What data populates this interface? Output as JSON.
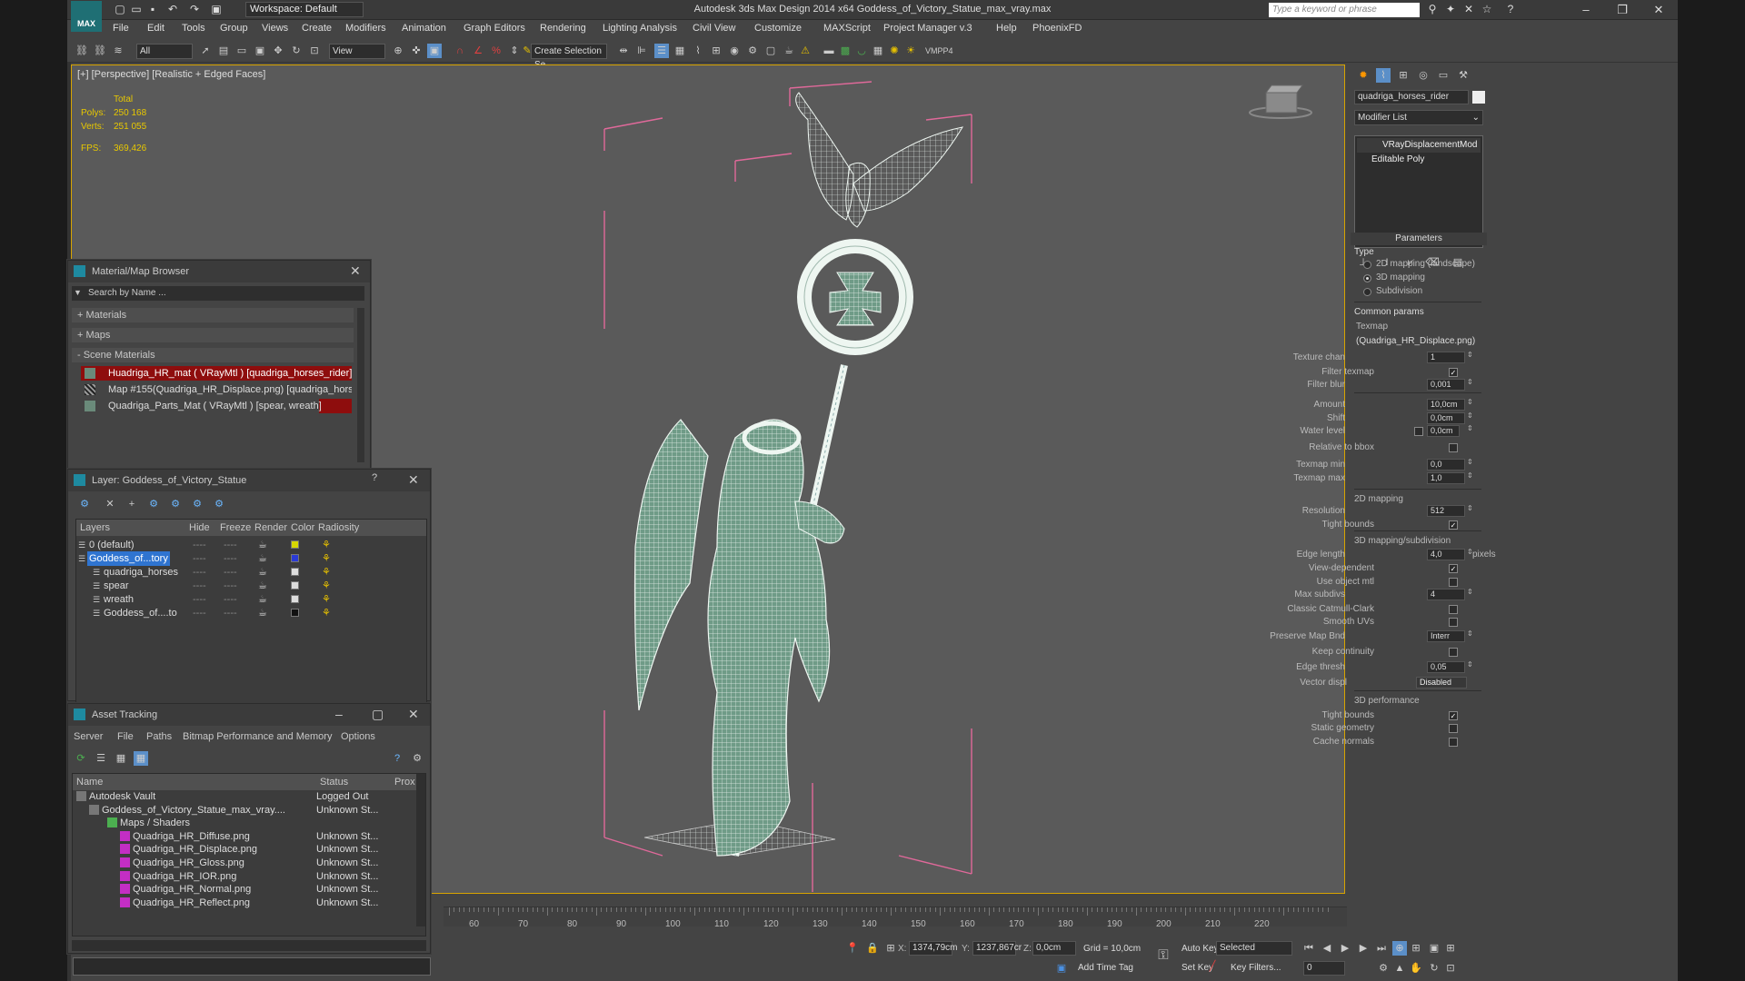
{
  "app": {
    "logo": "MAX",
    "workspace": "Workspace: Default",
    "title": "Autodesk 3ds Max Design 2014 x64     Goddess_of_Victory_Statue_max_vray.max",
    "search_placeholder": "Type a keyword or phrase"
  },
  "menus": [
    "File",
    "Edit",
    "Tools",
    "Group",
    "Views",
    "Create",
    "Modifiers",
    "Animation",
    "Graph Editors",
    "Rendering",
    "Lighting Analysis",
    "Civil View",
    "Customize",
    "MAXScript",
    "Project Manager v.3",
    "Help",
    "PhoenixFD"
  ],
  "toolbar": {
    "filter": "All",
    "refcoord": "View",
    "selection_set": "Create Selection Se",
    "vmpp": "VMPP4"
  },
  "viewport": {
    "label": "[+] [Perspective] [Realistic + Edged Faces]",
    "stats": {
      "heading": "Total",
      "polys_label": "Polys:",
      "polys": "250 168",
      "verts_label": "Verts:",
      "verts": "251 055",
      "fps_label": "FPS:",
      "fps": "369,426"
    }
  },
  "material_browser": {
    "title": "Material/Map Browser",
    "search": "Search by Name ...",
    "groups": [
      "+ Materials",
      "+ Maps",
      "- Scene Materials"
    ],
    "items": [
      "Huadriga_HR_mat ( VRayMtl ) [quadriga_horses_rider]",
      "Map #155(Quadriga_HR_Displace.png) [quadriga_hors...",
      "Quadriga_Parts_Mat ( VRayMtl ) [spear, wreath]"
    ]
  },
  "layer_dialog": {
    "title": "Layer: Goddess_of_Victory_Statue",
    "help": "?",
    "columns": [
      "Layers",
      "Hide",
      "Freeze",
      "Render",
      "Color",
      "Radiosity"
    ],
    "rows": [
      {
        "name": "0 (default)",
        "color": "#d7d700"
      },
      {
        "name": "Goddess_of...tory",
        "color": "#2b3bd6"
      },
      {
        "name": "quadriga_horses",
        "color": "#dddddd"
      },
      {
        "name": "spear",
        "color": "#dddddd"
      },
      {
        "name": "wreath",
        "color": "#dddddd"
      },
      {
        "name": "Goddess_of....to",
        "color": "#111111"
      }
    ]
  },
  "asset_tracking": {
    "title": "Asset Tracking",
    "menus": [
      "Server",
      "File",
      "Paths",
      "Bitmap Performance and Memory",
      "Options"
    ],
    "columns": [
      "Name",
      "Status",
      "Prox"
    ],
    "rows": [
      {
        "name": "Autodesk Vault",
        "status": "Logged Out"
      },
      {
        "name": "Goddess_of_Victory_Statue_max_vray....",
        "status": "Unknown St..."
      },
      {
        "name": "Maps / Shaders",
        "status": ""
      },
      {
        "name": "Quadriga_HR_Diffuse.png",
        "status": "Unknown St..."
      },
      {
        "name": "Quadriga_HR_Displace.png",
        "status": "Unknown St..."
      },
      {
        "name": "Quadriga_HR_Gloss.png",
        "status": "Unknown St..."
      },
      {
        "name": "Quadriga_HR_IOR.png",
        "status": "Unknown St..."
      },
      {
        "name": "Quadriga_HR_Normal.png",
        "status": "Unknown St..."
      },
      {
        "name": "Quadriga_HR_Reflect.png",
        "status": "Unknown St..."
      }
    ]
  },
  "command_panel": {
    "object_name": "quadriga_horses_rider",
    "modifier_list": "Modifier List",
    "stack": [
      "VRayDisplacementMod",
      "Editable Poly"
    ],
    "parameters": "Parameters",
    "type_label": "Type",
    "types": [
      "2D mapping (landscape)",
      "3D mapping",
      "Subdivision"
    ],
    "common_params": "Common params",
    "texmap_label": "Texmap",
    "texmap": "(Quadriga_HR_Displace.png)",
    "texture_chan": "Texture chan",
    "texture_chan_val": "1",
    "filter_texmap": "Filter texmap",
    "filter_blur": "Filter blur",
    "filter_blur_val": "0,001",
    "amount": "Amount",
    "amount_val": "10,0cm",
    "shift": "Shift",
    "shift_val": "0,0cm",
    "water_level": "Water level",
    "water_level_val": "0,0cm",
    "relative_bbox": "Relative to bbox",
    "texmap_min": "Texmap min",
    "texmap_min_val": "0,0",
    "texmap_max": "Texmap max",
    "texmap_max_val": "1,0",
    "mapping_2d": "2D mapping",
    "resolution": "Resolution",
    "resolution_val": "512",
    "tight_bounds": "Tight bounds",
    "mapping_3d": "3D mapping/subdivision",
    "edge_length": "Edge length",
    "edge_length_val": "4,0",
    "pixels": "pixels",
    "view_dependent": "View-dependent",
    "use_object_mtl": "Use object mtl",
    "max_subdivs": "Max subdivs",
    "max_subdivs_val": "4",
    "classic_catmull": "Classic Catmull-Clark",
    "smooth_uvs": "Smooth UVs",
    "preserve_map": "Preserve Map Bnd",
    "preserve_map_val": "Interr",
    "keep_continuity": "Keep continuity",
    "edge_thresh": "Edge thresh",
    "edge_thresh_val": "0,05",
    "vector_disp": "Vector displ",
    "vector_disp_val": "Disabled",
    "perf_3d": "3D performance",
    "tight_bounds2": "Tight bounds",
    "static_geometry": "Static geometry",
    "cache_normals": "Cache normals"
  },
  "timeline": {
    "ticks": [
      "60",
      "70",
      "80",
      "90",
      "100",
      "110",
      "120",
      "130",
      "140",
      "150",
      "160",
      "170",
      "180",
      "190",
      "200",
      "210",
      "220"
    ]
  },
  "statusbar": {
    "x_label": "X:",
    "x": "1374,79cm",
    "y_label": "Y:",
    "y": "1237,867cr",
    "z_label": "Z:",
    "z": "0,0cm",
    "grid": "Grid = 10,0cm",
    "add_time_tag": "Add Time Tag",
    "auto_key": "Auto Key",
    "selected": "Selected",
    "set_key": "Set Key",
    "key_filters": "Key Filters...",
    "frame": "0"
  },
  "colors": {
    "viewport_border": "#d8a400",
    "material_highlight": "#8e0d0d",
    "wire": "#d7e6df",
    "bbox": "#e0699a"
  }
}
